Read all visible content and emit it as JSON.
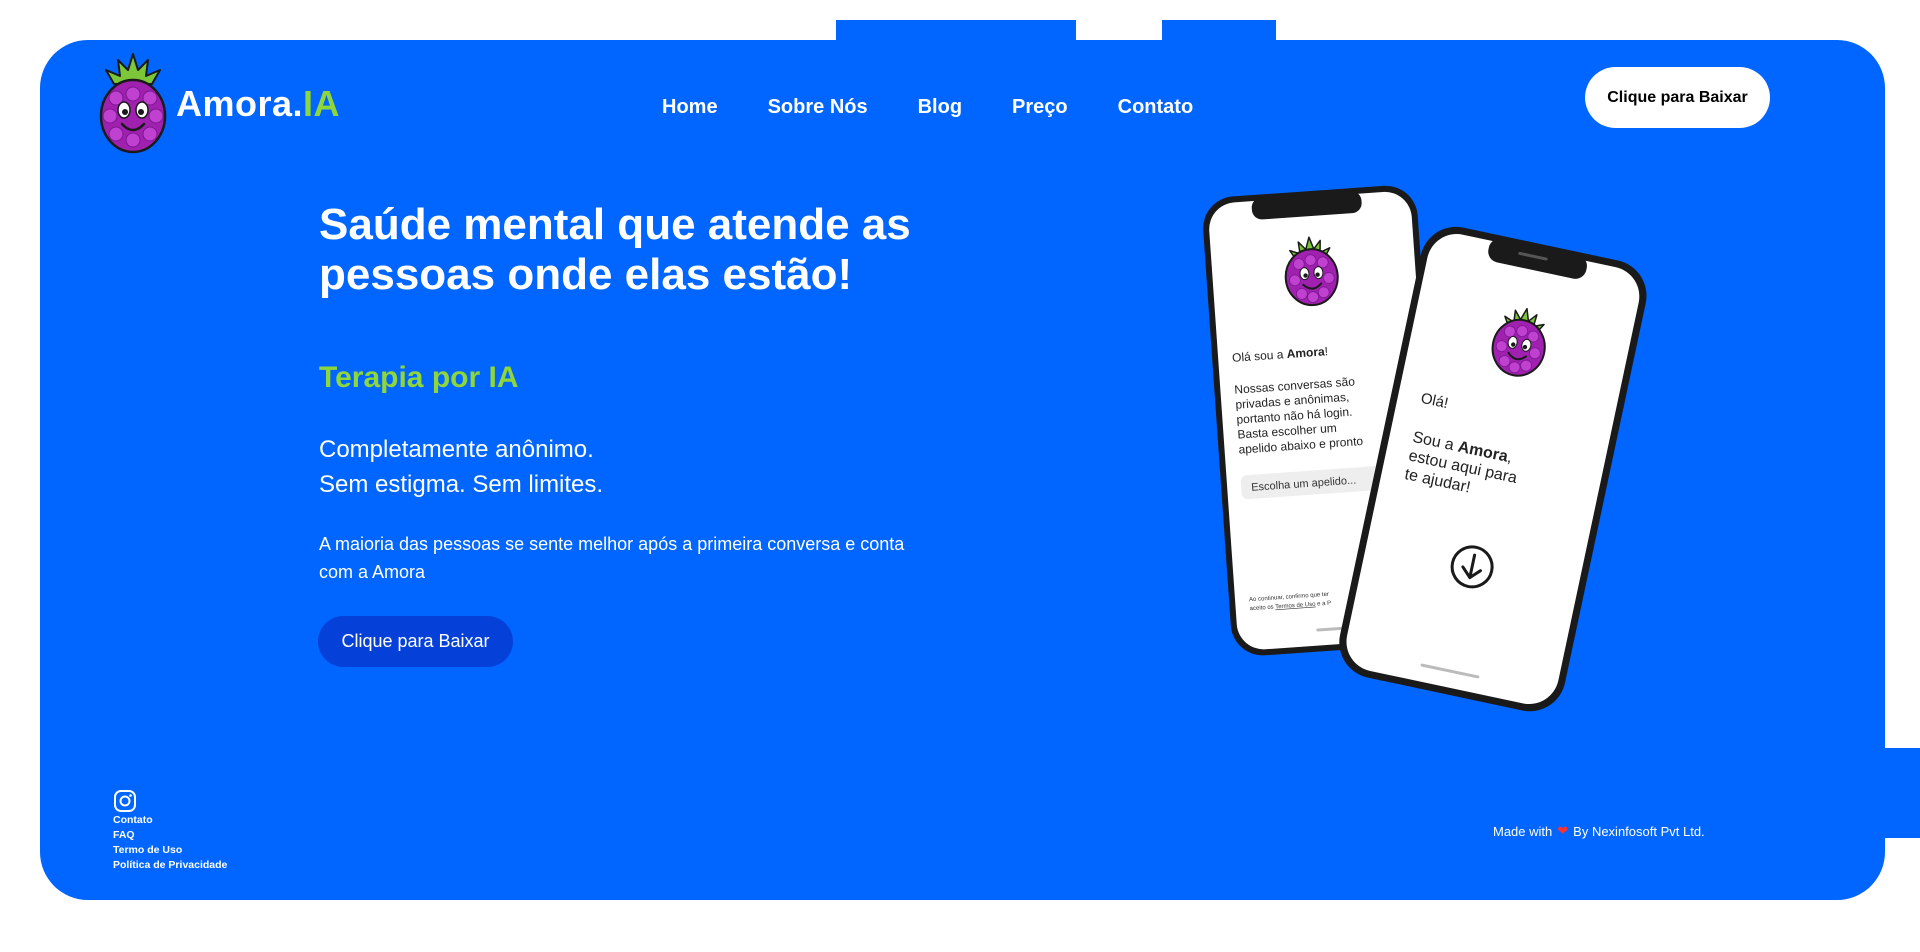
{
  "brand": {
    "name_main": "Amora",
    "name_dot": ".",
    "name_accent": "IA"
  },
  "nav": {
    "items": [
      "Home",
      "Sobre Nós",
      "Blog",
      "Preço",
      "Contato"
    ]
  },
  "header": {
    "cta_label": "Clique para Baixar"
  },
  "hero": {
    "title": "Saúde mental que atende as pessoas onde elas estão!",
    "subtitle": "Terapia por IA",
    "line1": "Completamente anônimo.",
    "line2": "Sem estigma. Sem limites.",
    "body": "A maioria das pessoas se sente melhor após a primeira conversa e conta com a Amora",
    "cta_label": "Clique para Baixar"
  },
  "phone_back": {
    "greeting_prefix": "Olá sou a ",
    "greeting_name": "Amora",
    "greeting_suffix": "!",
    "text_lines": [
      "Nossas conversas são",
      "privadas e anônimas,",
      "portanto não há login.",
      "Basta escolher um",
      "apelido abaixo e pronto"
    ],
    "input_placeholder": "Escolha um apelido...",
    "legal_line1": "Ao continuar, confirmo que ter",
    "legal_line2_prefix": "aceito os ",
    "legal_terms": "Termos de Uso",
    "legal_and": " e a P"
  },
  "phone_front": {
    "hello": "Olá!",
    "line1_prefix": "Sou a ",
    "line1_name": "Amora",
    "line1_suffix": ",",
    "line2": "estou aqui para",
    "line3": "te ajudar!"
  },
  "footer": {
    "social_icon": "instagram-icon",
    "links": [
      "Contato",
      "FAQ",
      "Termo de Uso",
      "Política de Privacidade"
    ],
    "credit_prefix": "Made with",
    "credit_suffix": "By Nexinfosoft Pvt Ltd."
  },
  "colors": {
    "primary": "#0066ff",
    "accent": "#8fd63a",
    "button_dark": "#0540d8",
    "berry": "#a020b0"
  }
}
